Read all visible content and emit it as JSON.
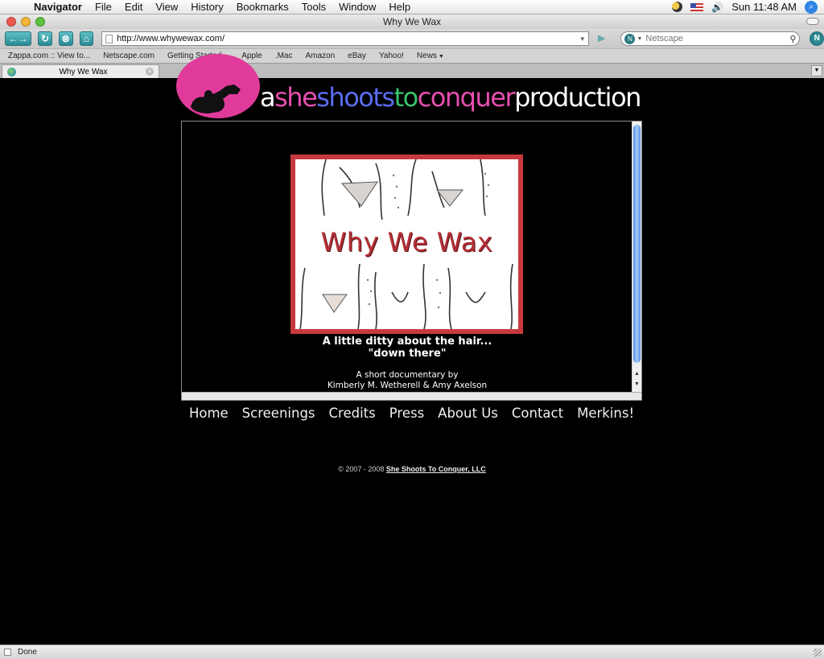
{
  "menubar": {
    "app_name": "Navigator",
    "items": [
      "File",
      "Edit",
      "View",
      "History",
      "Bookmarks",
      "Tools",
      "Window",
      "Help"
    ],
    "clock": "Sun 11:48 AM"
  },
  "window": {
    "title": "Why We Wax"
  },
  "navbar": {
    "url": "http://www.whywewax.com/",
    "search_placeholder": "Netscape"
  },
  "bookmarks": [
    {
      "label": "Zappa.com :: View to..."
    },
    {
      "label": "Netscape.com"
    },
    {
      "label": "Getting Started",
      "dropdown": true
    },
    {
      "label": "Apple"
    },
    {
      "label": ".Mac"
    },
    {
      "label": "Amazon"
    },
    {
      "label": "eBay"
    },
    {
      "label": "Yahoo!"
    },
    {
      "label": "News",
      "dropdown": true
    }
  ],
  "tab": {
    "label": "Why We Wax"
  },
  "site": {
    "logo_segments": [
      {
        "text": "a",
        "color": "#ffffff"
      },
      {
        "text": "she",
        "color": "#e84fb0"
      },
      {
        "text": "shoots",
        "color": "#5b6cf0"
      },
      {
        "text": "to",
        "color": "#39c36a"
      },
      {
        "text": "conquer",
        "color": "#e84fb0"
      },
      {
        "text": "production",
        "color": "#ffffff"
      }
    ],
    "poster_title": "Why We Wax",
    "tagline_line1": "A little ditty about the hair...",
    "tagline_line2": "\"down there\"",
    "credit_line1": "A short documentary by",
    "credit_line2": "Kimberly M. Wetherell & Amy Axelson",
    "nav": [
      "Home",
      "Screenings",
      "Credits",
      "Press",
      "About Us",
      "Contact",
      "Merkins!"
    ],
    "footer_prefix": "© 2007 - 2008",
    "footer_link": "She Shoots To Conquer, LLC"
  },
  "status": {
    "text": "Done"
  }
}
